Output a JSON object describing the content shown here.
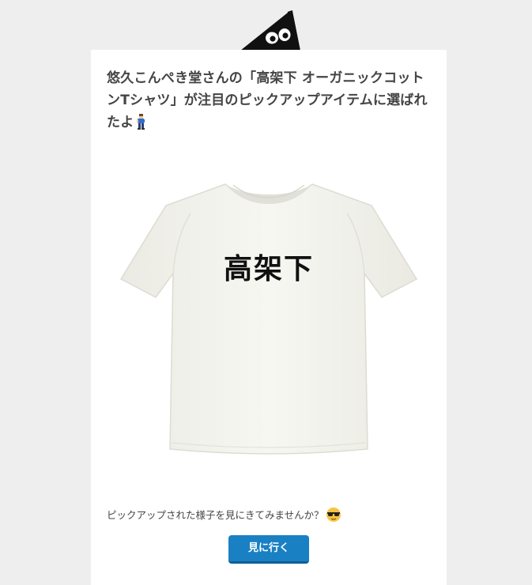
{
  "header": {
    "mascot_icon": "black-blob-mascot-icon"
  },
  "card": {
    "headline": "悠久こんぺき堂さんの「高架下 オーガニックコットンTシャツ」が注目のピックアップアイテムに選ばれたよ",
    "headline_emoji": "person-walking-icon",
    "product": {
      "print_text": "高架下",
      "shirt_color": "#f6f6f1"
    },
    "caption": "ピックアップされた様子を見にきてみませんか？",
    "caption_emoji": "cool-sunglasses-face-icon",
    "button_label": "見に行く"
  },
  "colors": {
    "background": "#eeeeee",
    "card": "#ffffff",
    "headline_text": "#444444",
    "button": "#1a80c4"
  }
}
